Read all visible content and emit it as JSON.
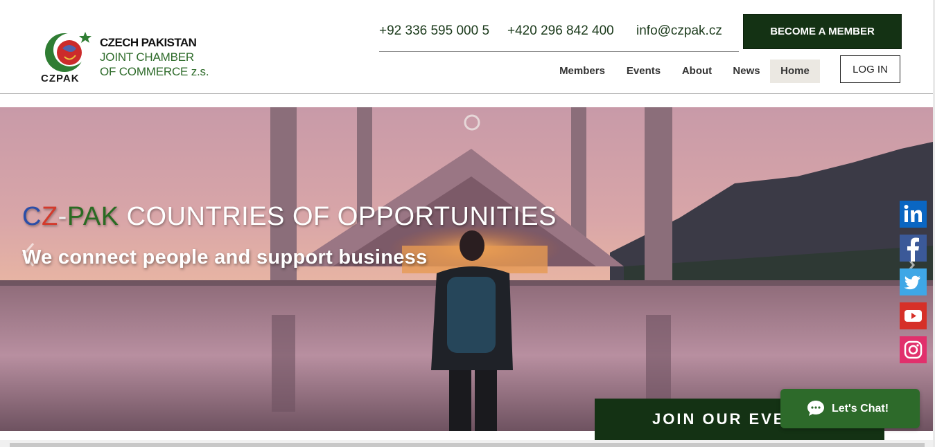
{
  "brand": {
    "logo_text": "CZPAK",
    "name_line1": "CZECH PAKISTAN",
    "name_line2": "JOINT CHAMBER",
    "name_line3": "OF COMMERCE z.s."
  },
  "contacts": {
    "phone_pk": "+92 336 595 000 5",
    "phone_cz": "+420 296 842 400",
    "email": "info@czpak.cz"
  },
  "header": {
    "cta_label": "BECOME A MEMBER",
    "login_label": "LOG IN"
  },
  "nav": {
    "items": [
      {
        "label": "Members"
      },
      {
        "label": "Events"
      },
      {
        "label": "About"
      },
      {
        "label": "News"
      },
      {
        "label": "Home",
        "active": true
      }
    ]
  },
  "hero": {
    "headline_cz_c": "C",
    "headline_cz_z": "Z",
    "headline_dash": "-",
    "headline_pak": "PAK",
    "headline_rest": " COUNTRIES OF OPPORTUNITIES",
    "subheadline": "We connect people and support business"
  },
  "social": {
    "icons": [
      "linkedin-icon",
      "facebook-icon",
      "twitter-icon",
      "youtube-icon",
      "instagram-icon"
    ],
    "colors": [
      "#0a66c2",
      "#3b5998",
      "#3fa7e6",
      "#d63028",
      "#e1306c"
    ]
  },
  "join": {
    "label": "JOIN OUR EVE"
  },
  "chat": {
    "label": "Let's Chat!"
  },
  "colors": {
    "brand_dark_green": "#143214",
    "brand_green": "#2e6b2a",
    "nav_active_bg": "#ebe8e2"
  }
}
